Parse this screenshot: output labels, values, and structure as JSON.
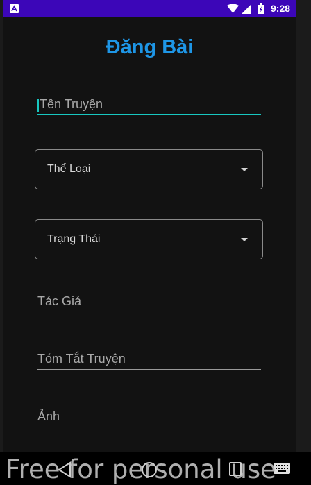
{
  "status_bar": {
    "time": "9:28",
    "app_icon": "a-icon",
    "wifi_icon": "wifi-icon",
    "signal_icon": "signal-icon",
    "battery_icon": "battery-charging-icon",
    "color": "#3c06b8"
  },
  "page": {
    "title": "Đăng Bài",
    "title_color": "#1e96e6"
  },
  "form": {
    "story_name": {
      "placeholder": "Tên Truyện",
      "value": ""
    },
    "genre": {
      "label": "Thể Loại"
    },
    "status": {
      "label": "Trạng Thái"
    },
    "author": {
      "placeholder": "Tác Giả",
      "value": ""
    },
    "summary": {
      "placeholder": "Tóm Tắt Truyện",
      "value": ""
    },
    "image": {
      "placeholder": "Ảnh",
      "value": ""
    },
    "accent_color": "#18c7c0"
  },
  "nav_bar": {
    "back_icon": "back-icon",
    "home_icon": "home-icon",
    "recents_icon": "recents-icon",
    "keyboard_icon": "keyboard-icon"
  },
  "watermark": "Free for personal use"
}
